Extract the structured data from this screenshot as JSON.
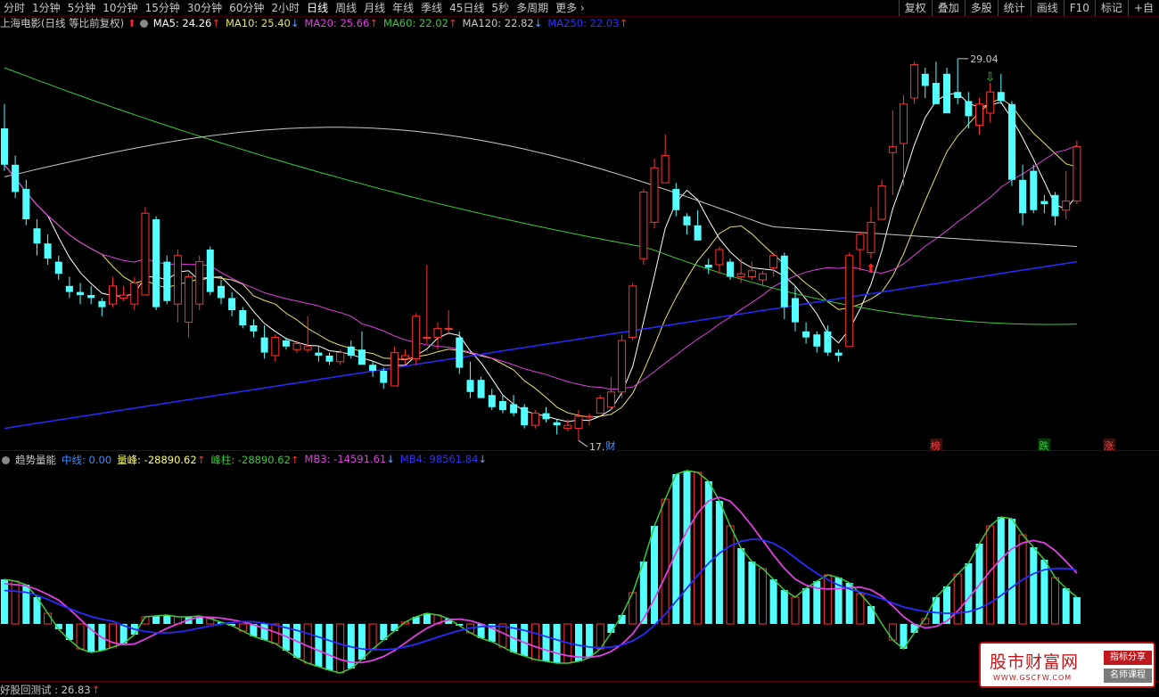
{
  "toolbar": {
    "periods": [
      "分时",
      "1分钟",
      "5分钟",
      "10分钟",
      "15分钟",
      "30分钟",
      "60分钟",
      "2小时",
      "日线",
      "周线",
      "月线",
      "年线",
      "季线",
      "45日线",
      "5秒",
      "多周期",
      "更多"
    ],
    "active_period": "日线",
    "right_tools": [
      "复权",
      "叠加",
      "多股",
      "统计",
      "画线",
      "F10",
      "标记",
      "+自"
    ]
  },
  "main_chart": {
    "title": "上海电影(日线 等比前复权)",
    "ma": [
      {
        "label": "MA5: 24.26",
        "arrow": "↑",
        "color": "#ffffff"
      },
      {
        "label": "MA10: 25.40",
        "arrow": "↓",
        "color": "#e8e26a"
      },
      {
        "label": "MA20: 25.66",
        "arrow": "↑",
        "color": "#e040e0"
      },
      {
        "label": "MA60: 22.02",
        "arrow": "↑",
        "color": "#3cc83c"
      },
      {
        "label": "MA120: 22.82",
        "arrow": "↓",
        "color": "#c8c8c8"
      },
      {
        "label": "MA250: 22.03",
        "arrow": "↑",
        "color": "#3030ff"
      }
    ],
    "price_high_label": "29.04",
    "price_low_label": "17.44",
    "events": [
      "财",
      "榜",
      "跌",
      "涨"
    ]
  },
  "indicator": {
    "title": "趋势量能",
    "items": [
      {
        "label": "中线: 0.00",
        "arrow": "",
        "color": "#3c8cff"
      },
      {
        "label": "量峰: -28890.62",
        "arrow": "↑",
        "color": "#ffff66"
      },
      {
        "label": "峰柱: -28890.62",
        "arrow": "↑",
        "color": "#3cc83c"
      },
      {
        "label": "MB3: -14591.61",
        "arrow": "↓",
        "color": "#e040e0"
      },
      {
        "label": "MB4: 98561.84",
        "arrow": "↓",
        "color": "#3030ff"
      }
    ]
  },
  "bottom_indicator": {
    "label": "好股回测试 : 26.83",
    "arrow": "↑"
  },
  "watermark": {
    "main": "股市财富网",
    "url": "WWW.GSCFW.COM",
    "tag1": "指标分享",
    "tag2": "名师课程"
  },
  "chart_data": {
    "type": "candlestick",
    "ohlc": [
      [
        26.8,
        27.6,
        25.4,
        25.6
      ],
      [
        25.6,
        25.9,
        24.5,
        24.7
      ],
      [
        24.8,
        25.1,
        23.6,
        23.8
      ],
      [
        23.5,
        23.8,
        22.6,
        23.0
      ],
      [
        23.0,
        23.3,
        22.3,
        22.5
      ],
      [
        22.4,
        22.6,
        21.8,
        22.0
      ],
      [
        21.6,
        21.9,
        21.2,
        21.4
      ],
      [
        21.4,
        21.7,
        21.0,
        21.3
      ],
      [
        21.3,
        21.6,
        21.0,
        21.2
      ],
      [
        21.1,
        21.2,
        20.6,
        20.9
      ],
      [
        21.0,
        21.9,
        20.9,
        21.6
      ],
      [
        21.2,
        21.6,
        21.1,
        21.3
      ],
      [
        21.0,
        21.9,
        20.8,
        21.7
      ],
      [
        21.3,
        24.2,
        21.3,
        24.0
      ],
      [
        23.8,
        23.9,
        20.8,
        20.9
      ],
      [
        22.4,
        22.6,
        21.0,
        21.1
      ],
      [
        21.0,
        22.8,
        20.4,
        22.6
      ],
      [
        20.4,
        22.0,
        19.9,
        21.9
      ],
      [
        21.0,
        22.6,
        20.8,
        22.4
      ],
      [
        22.8,
        22.9,
        21.3,
        21.4
      ],
      [
        21.6,
        21.8,
        21.0,
        21.2
      ],
      [
        21.2,
        21.4,
        20.6,
        20.8
      ],
      [
        20.8,
        20.9,
        20.2,
        20.3
      ],
      [
        20.3,
        20.5,
        19.9,
        20.1
      ],
      [
        19.9,
        20.3,
        19.2,
        19.4
      ],
      [
        19.3,
        20.0,
        19.1,
        19.9
      ],
      [
        19.8,
        19.9,
        19.5,
        19.6
      ],
      [
        19.5,
        19.8,
        19.4,
        19.7
      ],
      [
        19.5,
        20.6,
        19.4,
        19.6
      ],
      [
        19.4,
        19.6,
        19.1,
        19.3
      ],
      [
        19.3,
        19.4,
        19.0,
        19.1
      ],
      [
        19.1,
        19.5,
        19.0,
        19.4
      ],
      [
        19.6,
        19.8,
        19.2,
        19.3
      ],
      [
        19.5,
        20.1,
        19.0,
        19.0
      ],
      [
        19.0,
        19.1,
        18.6,
        18.8
      ],
      [
        18.8,
        18.9,
        18.2,
        18.4
      ],
      [
        18.3,
        19.6,
        18.3,
        19.4
      ],
      [
        19.2,
        19.5,
        19.0,
        19.3
      ],
      [
        19.2,
        20.7,
        19.0,
        20.6
      ],
      [
        19.9,
        22.3,
        19.7,
        19.9
      ],
      [
        19.9,
        20.4,
        19.5,
        20.2
      ],
      [
        20.2,
        20.8,
        20.0,
        20.2
      ],
      [
        19.9,
        20.1,
        18.7,
        18.9
      ],
      [
        18.5,
        19.1,
        17.9,
        18.1
      ],
      [
        18.5,
        18.6,
        17.9,
        17.9
      ],
      [
        18.0,
        18.2,
        17.5,
        17.6
      ],
      [
        17.8,
        18.0,
        17.4,
        17.5
      ],
      [
        17.7,
        18.0,
        17.3,
        17.4
      ],
      [
        17.6,
        17.7,
        16.9,
        17.0
      ],
      [
        17.0,
        17.5,
        16.9,
        17.4
      ],
      [
        17.4,
        17.6,
        17.1,
        17.2
      ],
      [
        17.1,
        17.2,
        16.7,
        17.0
      ],
      [
        16.9,
        17.2,
        16.8,
        17.0
      ],
      [
        16.9,
        17.5,
        16.5,
        17.3
      ],
      [
        17.3,
        17.4,
        17.0,
        17.3
      ],
      [
        17.4,
        18.0,
        17.4,
        17.9
      ],
      [
        17.6,
        18.6,
        17.5,
        18.1
      ],
      [
        18.1,
        20.0,
        17.9,
        19.8
      ],
      [
        19.9,
        21.7,
        19.8,
        21.6
      ],
      [
        22.5,
        24.8,
        22.3,
        24.7
      ],
      [
        23.7,
        25.8,
        23.5,
        25.5
      ],
      [
        25.0,
        26.6,
        25.0,
        25.9
      ],
      [
        24.8,
        25.0,
        23.9,
        24.1
      ],
      [
        23.9,
        24.0,
        23.3,
        23.6
      ],
      [
        23.6,
        24.1,
        23.1,
        23.1
      ],
      [
        22.3,
        22.5,
        22.0,
        22.2
      ],
      [
        22.3,
        22.9,
        22.0,
        22.8
      ],
      [
        22.4,
        22.5,
        21.8,
        21.9
      ],
      [
        21.9,
        22.5,
        21.7,
        22.0
      ],
      [
        21.9,
        22.4,
        21.8,
        22.1
      ],
      [
        21.8,
        22.1,
        21.6,
        22.0
      ],
      [
        22.2,
        22.7,
        21.9,
        22.6
      ],
      [
        22.6,
        22.7,
        20.5,
        20.9
      ],
      [
        21.2,
        21.6,
        20.1,
        20.4
      ],
      [
        20.1,
        20.4,
        19.7,
        19.9
      ],
      [
        20.0,
        20.1,
        19.4,
        19.6
      ],
      [
        20.1,
        20.3,
        19.3,
        19.4
      ],
      [
        19.4,
        19.5,
        19.1,
        19.3
      ],
      [
        19.6,
        22.7,
        19.6,
        22.6
      ],
      [
        22.8,
        23.4,
        22.1,
        23.3
      ],
      [
        22.7,
        24.2,
        22.5,
        23.7
      ],
      [
        23.8,
        25.1,
        23.8,
        24.9
      ],
      [
        26.0,
        27.4,
        24.6,
        26.2
      ],
      [
        26.3,
        27.9,
        24.9,
        27.6
      ],
      [
        27.8,
        29.0,
        27.6,
        28.9
      ],
      [
        28.6,
        28.8,
        27.8,
        28.2
      ],
      [
        28.3,
        29.0,
        27.6,
        27.6
      ],
      [
        28.6,
        28.8,
        27.3,
        27.3
      ],
      [
        28.0,
        29.1,
        27.6,
        27.8
      ],
      [
        27.7,
        28.0,
        26.8,
        27.2
      ],
      [
        26.9,
        27.8,
        26.6,
        27.6
      ],
      [
        27.3,
        28.3,
        27.0,
        28.0
      ],
      [
        28.0,
        28.6,
        27.6,
        27.7
      ],
      [
        27.6,
        27.7,
        24.9,
        25.1
      ],
      [
        25.1,
        25.6,
        23.6,
        24.0
      ],
      [
        25.4,
        25.6,
        24.0,
        24.1
      ],
      [
        24.4,
        24.6,
        24.0,
        24.3
      ],
      [
        24.6,
        24.7,
        23.6,
        23.9
      ],
      [
        24.1,
        25.4,
        23.8,
        24.4
      ],
      [
        24.4,
        26.4,
        24.3,
        26.2
      ]
    ],
    "price_high": 29.04,
    "price_low": 17.44
  }
}
